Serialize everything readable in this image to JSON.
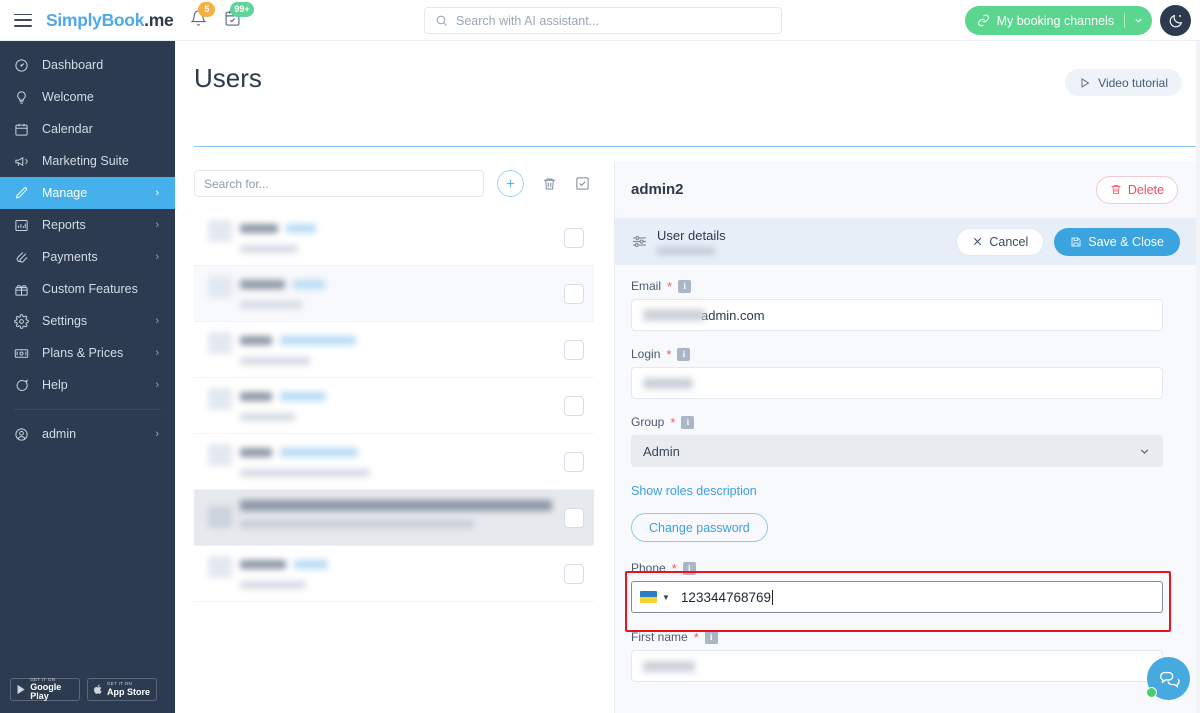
{
  "topbar": {
    "menu_icon": "hamburger-icon",
    "logo_part1": "SimplyBook",
    "logo_part2": ".me",
    "bell_icon": "bell-icon",
    "bell_badge": "5",
    "calendar_icon": "calendar-check-icon",
    "calendar_badge": "99+",
    "search_placeholder": "Search with AI assistant...",
    "search_value": "",
    "search_icon": "search-icon",
    "booking_channels_label": "My booking channels",
    "booking_channels_icon": "link-icon",
    "booking_channels_caret": "chevron-down-icon",
    "theme_toggle_icon": "moon-icon"
  },
  "sidebar": {
    "items": [
      {
        "label": "Dashboard",
        "icon": "speedometer-icon",
        "has_chevron": false,
        "active": false
      },
      {
        "label": "Welcome",
        "icon": "lightbulb-icon",
        "has_chevron": false,
        "active": false
      },
      {
        "label": "Calendar",
        "icon": "calendar-icon",
        "has_chevron": false,
        "active": false
      },
      {
        "label": "Marketing Suite",
        "icon": "megaphone-icon",
        "has_chevron": false,
        "active": false
      },
      {
        "label": "Manage",
        "icon": "pencil-icon",
        "has_chevron": true,
        "active": true
      },
      {
        "label": "Reports",
        "icon": "bar-chart-icon",
        "has_chevron": true,
        "active": false
      },
      {
        "label": "Payments",
        "icon": "paperclip-icon",
        "has_chevron": true,
        "active": false
      },
      {
        "label": "Custom Features",
        "icon": "gift-icon",
        "has_chevron": false,
        "active": false
      },
      {
        "label": "Settings",
        "icon": "gear-icon",
        "has_chevron": true,
        "active": false
      },
      {
        "label": "Plans & Prices",
        "icon": "banknote-icon",
        "has_chevron": true,
        "active": false
      },
      {
        "label": "Help",
        "icon": "chat-bubble-icon",
        "has_chevron": true,
        "active": false
      }
    ],
    "account": {
      "label": "admin",
      "icon": "user-circle-icon",
      "has_chevron": true
    },
    "stores": [
      {
        "small": "GET IT ON",
        "big": "Google Play",
        "icon": "play-triangle-icon"
      },
      {
        "small": "GET IT ON",
        "big": "App Store",
        "icon": "apple-icon"
      }
    ]
  },
  "page": {
    "title": "Users",
    "video_tutorial_label": "Video tutorial",
    "video_tutorial_icon": "play-outline-icon"
  },
  "list": {
    "search_placeholder": "Search for...",
    "search_value": "",
    "add_icon": "plus-icon",
    "delete_icon": "trash-icon",
    "select_all_icon": "checkbox-check-icon",
    "rows": [
      {
        "redacted": true,
        "selected": false,
        "alt": false,
        "lines": [
          38,
          92,
          58
        ]
      },
      {
        "redacted": true,
        "selected": false,
        "alt": true,
        "lines": [
          45,
          100,
          62
        ]
      },
      {
        "redacted": true,
        "selected": false,
        "alt": false,
        "lines": [
          120,
          90,
          70
        ]
      },
      {
        "redacted": true,
        "selected": false,
        "alt": false,
        "lines": [
          86,
          75,
          55
        ]
      },
      {
        "redacted": true,
        "selected": false,
        "alt": false,
        "lines": [
          136,
          96,
          130
        ]
      },
      {
        "redacted": true,
        "selected": true,
        "alt": false,
        "lines": [
          312,
          186,
          234
        ]
      },
      {
        "redacted": true,
        "selected": false,
        "alt": false,
        "lines": [
          96,
          78,
          66
        ]
      }
    ]
  },
  "panel": {
    "title": "admin2",
    "delete_label": "Delete",
    "delete_icon": "trash-icon",
    "section_icon": "sliders-icon",
    "section_title": "User details",
    "section_subtitle_redacted": true,
    "cancel_label": "Cancel",
    "cancel_icon": "close-x-icon",
    "save_label": "Save & Close",
    "save_icon": "floppy-disk-icon",
    "fields": {
      "email": {
        "label": "Email",
        "required": "*",
        "info_icon": "info-icon",
        "value_suffix": "admin.com",
        "value_redacted": true
      },
      "login": {
        "label": "Login",
        "required": "*",
        "info_icon": "info-icon",
        "value": "",
        "value_redacted": true
      },
      "group": {
        "label": "Group",
        "required": "*",
        "info_icon": "info-icon",
        "value": "Admin",
        "caret_icon": "chevron-down-icon"
      },
      "roles_link": "Show roles description",
      "change_password_label": "Change password",
      "phone": {
        "label": "Phone",
        "required": "*",
        "info_icon": "info-icon",
        "country_flag": "ukraine-flag-icon",
        "country_caret": "caret-down-icon",
        "value": "123344768769",
        "focused": true,
        "highlighted": true
      },
      "first_name": {
        "label": "First name",
        "required": "*",
        "info_icon": "info-icon",
        "value": "",
        "value_redacted": true
      }
    }
  },
  "chat_widget": {
    "icon": "chat-bubbles-icon",
    "status": "online"
  },
  "colors": {
    "sidebar_bg": "#2c3b50",
    "accent_blue": "#45b0ec",
    "green": "#5bd68f",
    "badge_orange": "#f5b042",
    "badge_green": "#5fd39a",
    "danger_red": "#ef4e62",
    "highlight_red": "#e8131e",
    "save_blue": "#3aa3e0"
  }
}
